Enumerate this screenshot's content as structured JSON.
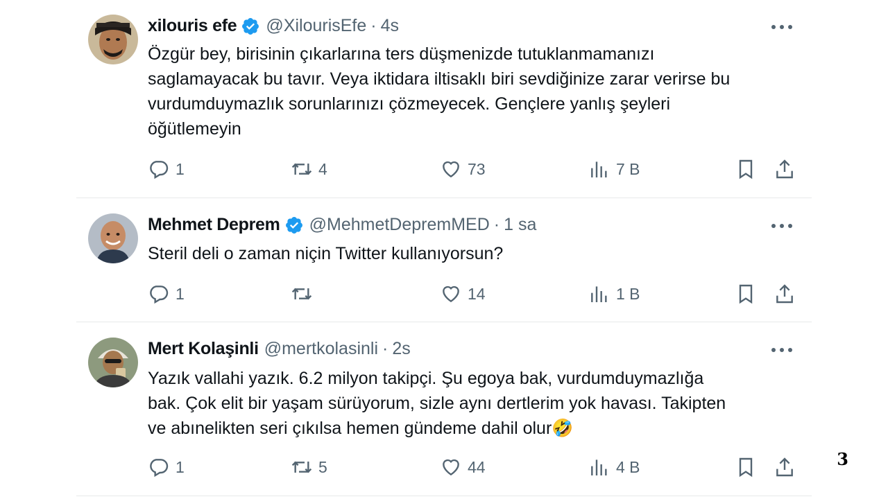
{
  "tweets": [
    {
      "name": "xilouris efe",
      "handle": "@XilourisEfe",
      "time": "4s",
      "verified": true,
      "text_lines": [
        "Özgür bey, birisinin çıkarlarına ters düşmenizde tutuklanmamanızı",
        "saglamayacak bu tavır. Veya iktidara iltisaklı biri sevdiğinize zarar verirse bu",
        "vurdumduymazlık sorunlarınızı çözmeyecek. Gençlere yanlış şeyleri",
        "öğütlemeyin"
      ],
      "replies": "1",
      "retweets": "4",
      "likes": "73",
      "views": "7 B"
    },
    {
      "name": "Mehmet Deprem",
      "handle": "@MehmetDepremMED",
      "time": "1 sa",
      "verified": true,
      "text_lines": [
        "Steril deli o zaman niçin Twitter kullanıyorsun?"
      ],
      "replies": "1",
      "retweets": "",
      "likes": "14",
      "views": "1 B"
    },
    {
      "name": "Mert Kolaşinli",
      "handle": "@mertkolasinli",
      "time": "2s",
      "verified": false,
      "text_lines": [
        "Yazık vallahi yazık. 6.2 milyon takipçi. Şu egoya bak, vurdumduymazlığa",
        "bak. Çok elit bir yaşam sürüyorum, sizle aynı dertlerim yok havası. Takipten",
        "ve abınelikten seri çıkılsa hemen gündeme dahil olur🤣"
      ],
      "replies": "1",
      "retweets": "5",
      "likes": "44",
      "views": "4 B"
    }
  ],
  "page_number": "3",
  "colors": {
    "verified": "#1d9bf0",
    "secondary": "#536471",
    "divider": "#e7e9ea"
  },
  "icons": [
    "reply-icon",
    "retweet-icon",
    "like-icon",
    "views-icon",
    "bookmark-icon",
    "share-icon",
    "more-icon",
    "verified-badge-icon"
  ]
}
